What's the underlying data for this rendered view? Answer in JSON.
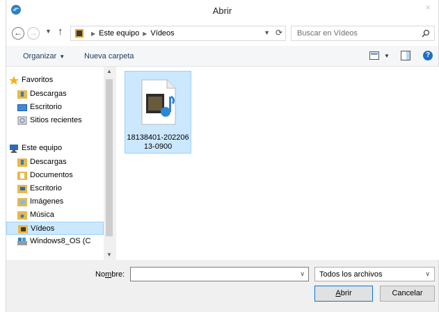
{
  "window": {
    "title": "Abrir",
    "close_label": "×"
  },
  "address": {
    "crumbs": [
      "Este equipo",
      "Vídeos"
    ],
    "search_placeholder": "Buscar en Vídeos"
  },
  "toolbar": {
    "organize_label": "Organizar",
    "new_folder_label": "Nueva carpeta"
  },
  "nav": {
    "favorites": {
      "label": "Favoritos",
      "items": [
        {
          "label": "Descargas",
          "icon": "downloads-folder-icon"
        },
        {
          "label": "Escritorio",
          "icon": "desktop-icon"
        },
        {
          "label": "Sitios recientes",
          "icon": "recent-places-icon"
        }
      ]
    },
    "this_pc": {
      "label": "Este equipo",
      "items": [
        {
          "label": "Descargas",
          "icon": "downloads-folder-icon"
        },
        {
          "label": "Documentos",
          "icon": "documents-folder-icon"
        },
        {
          "label": "Escritorio",
          "icon": "desktop-folder-icon"
        },
        {
          "label": "Imágenes",
          "icon": "pictures-folder-icon"
        },
        {
          "label": "Música",
          "icon": "music-folder-icon"
        },
        {
          "label": "Vídeos",
          "icon": "videos-folder-icon"
        },
        {
          "label": "Windows8_OS (C",
          "icon": "drive-icon"
        }
      ]
    },
    "selected": "Vídeos"
  },
  "files": [
    {
      "name": "18138401-20220613-0900",
      "icon": "video-file-icon"
    }
  ],
  "bottom": {
    "name_label_pre": "No",
    "name_label_u": "m",
    "name_label_post": "bre:",
    "name_value": "",
    "filter_value": "Todos los archivos",
    "open_label_u": "A",
    "open_label_rest": "brir",
    "cancel_label": "Cancelar"
  },
  "colors": {
    "selection_bg": "#cce8ff",
    "selection_border": "#99d1ff",
    "accent": "#0078d7"
  }
}
